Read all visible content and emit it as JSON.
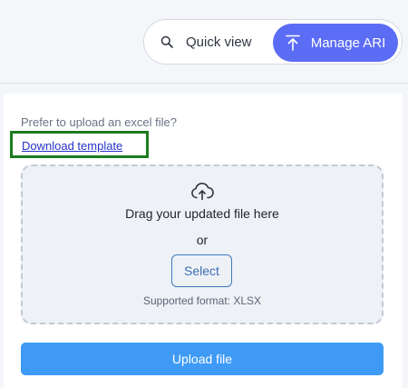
{
  "view_toggle": {
    "quick_view_label": "Quick view",
    "manage_label": "Manage ARI",
    "active": "Manage ARI"
  },
  "upload_card": {
    "prompt": "Prefer to upload an excel file?",
    "download_link": "Download template",
    "dropzone": {
      "drag_text": "Drag your updated file here",
      "or_text": "or",
      "select_label": "Select",
      "format_text": "Supported format: XLSX"
    },
    "upload_button": "Upload file"
  },
  "colors": {
    "accent_purple": "#5b6cf5",
    "upload_blue": "#3e9af5",
    "highlight_green": "#1e7b1e",
    "link_blue": "#2531c7"
  },
  "icons": [
    "search-icon",
    "upload-arrow-icon",
    "cloud-upload-icon"
  ]
}
